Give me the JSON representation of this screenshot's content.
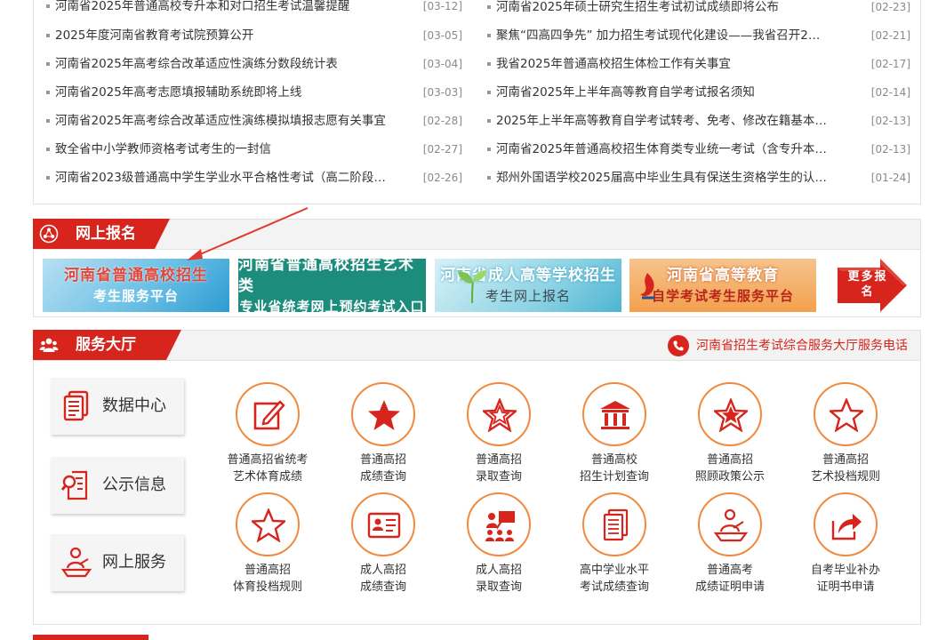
{
  "news": {
    "left": [
      {
        "title": "河南省2025年普通高校专升本和对口招生考试温馨提醒",
        "date": "[03-12]"
      },
      {
        "title": "2025年度河南省教育考试院预算公开",
        "date": "[03-05]"
      },
      {
        "title": "河南省2025年高考综合改革适应性演练分数段统计表",
        "date": "[03-04]"
      },
      {
        "title": "河南省2025年高考志愿填报辅助系统即将上线",
        "date": "[03-03]"
      },
      {
        "title": "河南省2025年高考综合改革适应性演练模拟填报志愿有关事宜",
        "date": "[02-28]"
      },
      {
        "title": "致全省中小学教师资格考试考生的一封信",
        "date": "[02-27]"
      },
      {
        "title": "河南省2023级普通高中学生学业水平合格性考试（高二阶段…",
        "date": "[02-26]"
      }
    ],
    "right": [
      {
        "title": "河南省2025年硕士研究生招生考试初试成绩即将公布",
        "date": "[02-23]"
      },
      {
        "title": "聚焦“四高四争先” 加力招生考试现代化建设——我省召开2…",
        "date": "[02-21]"
      },
      {
        "title": "我省2025年普通高校招生体检工作有关事宜",
        "date": "[02-17]"
      },
      {
        "title": "河南省2025年上半年高等教育自学考试报名须知",
        "date": "[02-14]"
      },
      {
        "title": "2025年上半年高等教育自学考试转考、免考、修改在籍基本…",
        "date": "[02-13]"
      },
      {
        "title": "河南省2025年普通高校招生体育类专业统一考试（含专升本…",
        "date": "[02-13]"
      },
      {
        "title": "郑州外国语学校2025届高中毕业生具有保送生资格学生的认…",
        "date": "[01-24]"
      }
    ]
  },
  "registration": {
    "heading": "网上报名",
    "banners": [
      {
        "line1": "河南省普通高校招生",
        "line2": "考生服务平台"
      },
      {
        "line1": "河南省普通高校招生艺术类",
        "line2": "专业省统考网上预约考试入口"
      },
      {
        "line1": "河南省成人高等学校招生",
        "line2": "考生网上报名"
      },
      {
        "line1": "河南省高等教育",
        "line2": "自学考试考生服务平台"
      }
    ],
    "more": "更多报名"
  },
  "service": {
    "heading": "服务大厅",
    "hotline": "河南省招生考试综合服务大厅服务电话",
    "side": [
      {
        "label": "数据中心",
        "icon": "document-stack-icon"
      },
      {
        "label": "公示信息",
        "icon": "magnifier-document-icon"
      },
      {
        "label": "网上服务",
        "icon": "person-desk-icon"
      }
    ],
    "items": [
      {
        "l1": "普通高招省统考",
        "l2": "艺术体育成绩",
        "icon": "edit-icon"
      },
      {
        "l1": "普通高招",
        "l2": "成绩查询",
        "icon": "star-solid-icon"
      },
      {
        "l1": "普通高招",
        "l2": "录取查询",
        "icon": "star-outline-icon"
      },
      {
        "l1": "普通高校",
        "l2": "招生计划查询",
        "icon": "bank-icon"
      },
      {
        "l1": "普通高招",
        "l2": "照顾政策公示",
        "icon": "star-badge-icon"
      },
      {
        "l1": "普通高招",
        "l2": "艺术投档规则",
        "icon": "star-outline-icon"
      },
      {
        "l1": "普通高招",
        "l2": "体育投档规则",
        "icon": "star-outline-icon"
      },
      {
        "l1": "成人高招",
        "l2": "成绩查询",
        "icon": "id-card-icon"
      },
      {
        "l1": "成人高招",
        "l2": "录取查询",
        "icon": "presentation-icon"
      },
      {
        "l1": "高中学业水平",
        "l2": "考试成绩查询",
        "icon": "papers-icon"
      },
      {
        "l1": "普通高考",
        "l2": "成绩证明申请",
        "icon": "person-desk-icon"
      },
      {
        "l1": "自考毕业补办",
        "l2": "证明书申请",
        "icon": "share-arrow-icon"
      }
    ]
  },
  "colors": {
    "brand_red": "#d7241c",
    "accent_orange": "#f08a3f"
  }
}
